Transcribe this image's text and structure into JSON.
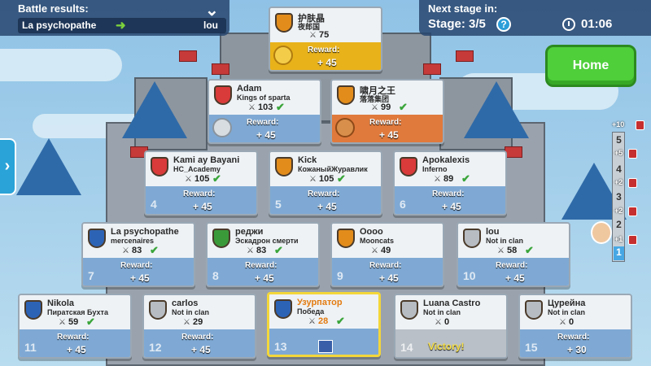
{
  "battle_results": {
    "title": "Battle results:",
    "left_player": "La psychopathe",
    "right_player": "lou"
  },
  "stage_panel": {
    "next_stage_label": "Next stage in:",
    "stage_text": "Stage: 3/5",
    "help_glyph": "?",
    "timer": "01:06"
  },
  "home_button": {
    "label": "Home"
  },
  "side_arrow": {
    "glyph": "›"
  },
  "ladder": {
    "steps": [
      "5",
      "4",
      "3",
      "2",
      "1"
    ],
    "top_badge": "+10",
    "badges": [
      "+5",
      "+2",
      "+2",
      "+1"
    ]
  },
  "cards": [
    {
      "name": "护肤晶",
      "clan": "夜郎国",
      "score": "75",
      "check": "",
      "rank": "",
      "reward_label": "Reward:",
      "reward_value": "+ 45",
      "style": "gold"
    },
    {
      "name": "Adam",
      "clan": "Kings of sparta",
      "score": "103",
      "check": "✔",
      "rank": "",
      "reward_label": "Reward:",
      "reward_value": "+ 45",
      "style": "blue"
    },
    {
      "name": "啸月之王",
      "clan": "落落集团",
      "score": "99",
      "check": "✔",
      "rank": "",
      "reward_label": "Reward:",
      "reward_value": "+ 45",
      "style": "orange"
    },
    {
      "name": "Kami ay Bayani",
      "clan": "HC_Academy",
      "score": "105",
      "check": "✔",
      "rank": "4",
      "reward_label": "Reward:",
      "reward_value": "+ 45",
      "style": "blue"
    },
    {
      "name": "Kick",
      "clan": "КожаныйЖуравлик",
      "score": "105",
      "check": "✔",
      "rank": "5",
      "reward_label": "Reward:",
      "reward_value": "+ 45",
      "style": "blue"
    },
    {
      "name": "Apokalexis",
      "clan": "Inferno",
      "score": "89",
      "check": "✔",
      "rank": "6",
      "reward_label": "Reward:",
      "reward_value": "+ 45",
      "style": "blue"
    },
    {
      "name": "La psychopathe",
      "clan": "mercenaires",
      "score": "83",
      "check": "✔",
      "rank": "7",
      "reward_label": "Reward:",
      "reward_value": "+ 45",
      "style": "blue"
    },
    {
      "name": "реджи",
      "clan": "Эскадрон смерти",
      "score": "83",
      "check": "✔",
      "rank": "8",
      "reward_label": "Reward:",
      "reward_value": "+ 45",
      "style": "blue"
    },
    {
      "name": "Oooo",
      "clan": "Mooncats",
      "score": "49",
      "check": "",
      "rank": "9",
      "reward_label": "Reward:",
      "reward_value": "+ 45",
      "style": "blue"
    },
    {
      "name": "lou",
      "clan": "Not in clan",
      "score": "58",
      "check": "✔",
      "rank": "10",
      "reward_label": "Reward:",
      "reward_value": "+ 45",
      "style": "blue"
    },
    {
      "name": "Nikola",
      "clan": "Пиратская Бухта",
      "score": "59",
      "check": "✔",
      "rank": "11",
      "reward_label": "Reward:",
      "reward_value": "+ 45",
      "style": "blue"
    },
    {
      "name": "carlos",
      "clan": "Not in clan",
      "score": "29",
      "check": "",
      "rank": "12",
      "reward_label": "Reward:",
      "reward_value": "+ 45",
      "style": "blue"
    },
    {
      "name": "Узурпатор",
      "clan": "Победа",
      "score": "28",
      "check": "✔",
      "rank": "13",
      "reward_label": "",
      "reward_value": "",
      "style": "self"
    },
    {
      "name": "Luana Castro",
      "clan": "Not in clan",
      "score": "0",
      "check": "",
      "rank": "14",
      "reward_label": "",
      "reward_value": "",
      "victory": "Victory!",
      "style": "gray"
    },
    {
      "name": "Цурейна",
      "clan": "Not in clan",
      "score": "0",
      "check": "",
      "rank": "15",
      "reward_label": "Reward:",
      "reward_value": "+ 30",
      "style": "blue"
    }
  ],
  "colors": {
    "gold_card": "#e8b21a",
    "orange_card": "#e07a3c",
    "blue_card": "#7fa9d4",
    "home_button": "#4fcf3a",
    "self_highlight": "#f3d63a"
  }
}
